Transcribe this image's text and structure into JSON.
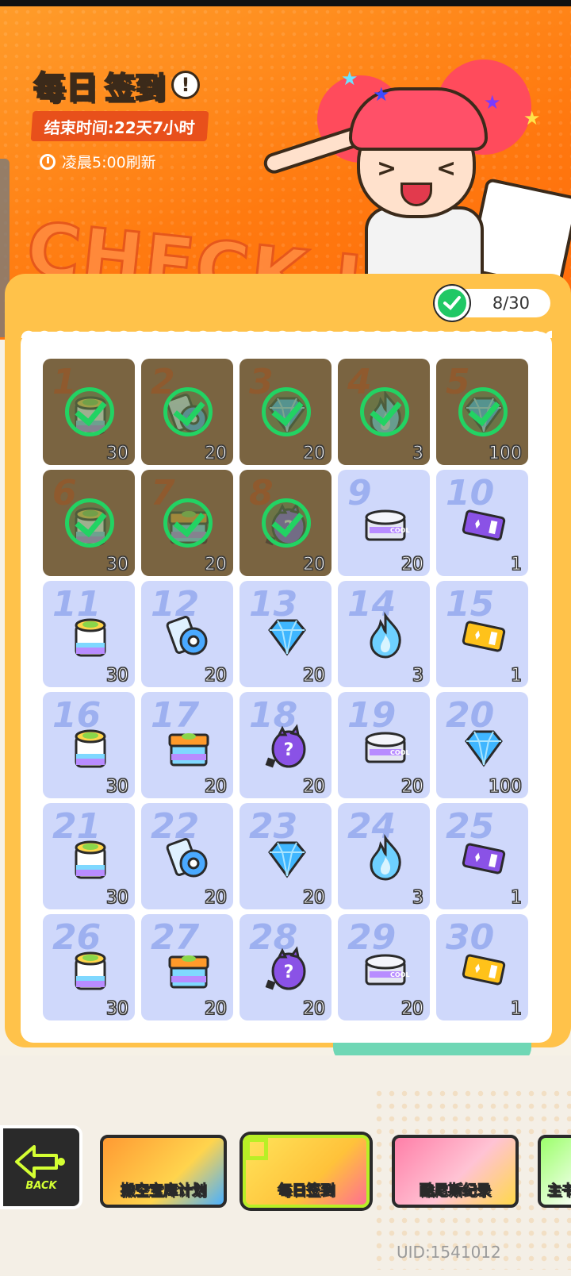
{
  "header": {
    "title_part1": "每日",
    "title_part2": "签到",
    "info_icon": "!",
    "end_time": "结束时间:22天7小时",
    "refresh": "凌晨5:00刷新",
    "banner_text": "CHECK-IN"
  },
  "progress": {
    "label": "8/30",
    "checked": 8,
    "total": 30
  },
  "colors": {
    "done_cell": "#7a6441",
    "pending_cell": "#cfd8fb",
    "check": "#22d363",
    "panel": "#ffc24a",
    "hero": "#ff7a10"
  },
  "days": [
    {
      "day": "1",
      "qty": "30",
      "item": "paint-bucket-icon",
      "done": true
    },
    {
      "day": "2",
      "qty": "20",
      "item": "tape-roll-icon",
      "done": true
    },
    {
      "day": "3",
      "qty": "20",
      "item": "gem-icon",
      "done": true
    },
    {
      "day": "4",
      "qty": "3",
      "item": "flame-icon",
      "done": true
    },
    {
      "day": "5",
      "qty": "100",
      "item": "gem-icon",
      "done": true
    },
    {
      "day": "6",
      "qty": "30",
      "item": "paint-bucket-icon",
      "done": true
    },
    {
      "day": "7",
      "qty": "20",
      "item": "gift-box-icon",
      "done": true
    },
    {
      "day": "8",
      "qty": "20",
      "item": "mystery-egg-icon",
      "done": true
    },
    {
      "day": "9",
      "qty": "20",
      "item": "cool-can-icon",
      "done": false
    },
    {
      "day": "10",
      "qty": "1",
      "item": "purple-ticket-icon",
      "done": false
    },
    {
      "day": "11",
      "qty": "30",
      "item": "paint-bucket-icon",
      "done": false
    },
    {
      "day": "12",
      "qty": "20",
      "item": "tape-roll-icon",
      "done": false
    },
    {
      "day": "13",
      "qty": "20",
      "item": "gem-icon",
      "done": false
    },
    {
      "day": "14",
      "qty": "3",
      "item": "flame-icon",
      "done": false
    },
    {
      "day": "15",
      "qty": "1",
      "item": "gold-ticket-icon",
      "done": false
    },
    {
      "day": "16",
      "qty": "30",
      "item": "paint-bucket-icon",
      "done": false
    },
    {
      "day": "17",
      "qty": "20",
      "item": "gift-box-icon",
      "done": false
    },
    {
      "day": "18",
      "qty": "20",
      "item": "mystery-egg-icon",
      "done": false
    },
    {
      "day": "19",
      "qty": "20",
      "item": "cool-can-icon",
      "done": false
    },
    {
      "day": "20",
      "qty": "100",
      "item": "gem-icon",
      "done": false
    },
    {
      "day": "21",
      "qty": "30",
      "item": "paint-bucket-icon",
      "done": false
    },
    {
      "day": "22",
      "qty": "20",
      "item": "tape-roll-icon",
      "done": false
    },
    {
      "day": "23",
      "qty": "20",
      "item": "gem-icon",
      "done": false
    },
    {
      "day": "24",
      "qty": "3",
      "item": "flame-icon",
      "done": false
    },
    {
      "day": "25",
      "qty": "1",
      "item": "purple-ticket-icon",
      "done": false
    },
    {
      "day": "26",
      "qty": "30",
      "item": "paint-bucket-icon",
      "done": false
    },
    {
      "day": "27",
      "qty": "20",
      "item": "gift-box-icon",
      "done": false
    },
    {
      "day": "28",
      "qty": "20",
      "item": "mystery-egg-icon",
      "done": false
    },
    {
      "day": "29",
      "qty": "20",
      "item": "cool-can-icon",
      "done": false
    },
    {
      "day": "30",
      "qty": "1",
      "item": "gold-ticket-icon",
      "done": false
    }
  ],
  "nav": {
    "back_label": "BACK",
    "tabs": [
      {
        "label": "搬空宝库计划"
      },
      {
        "label": "每日签到"
      },
      {
        "label": "酷尼斯纪录"
      },
      {
        "label": "主书"
      }
    ]
  },
  "footer": {
    "uid": "UID:1541012"
  }
}
